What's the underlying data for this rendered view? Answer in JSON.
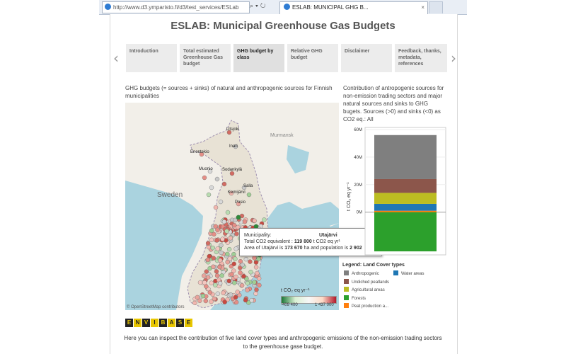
{
  "browser": {
    "url": "http://www.d3.ymparisto.fi/d3/test_services/ESLab",
    "tab_title": "ESLAB: MUNICIPAL GHG B...",
    "tab_close": "×"
  },
  "page": {
    "title": "ESLAB: Municipal Greenhouse Gas Budgets",
    "nav_tabs": [
      {
        "label": "Introduction"
      },
      {
        "label": "Total estimated Greenhouse Gas budget"
      },
      {
        "label": "GHG budget by class"
      },
      {
        "label": "Relative GHG budget"
      },
      {
        "label": "Disclaimer"
      },
      {
        "label": "Feedback, thanks, metadata, references"
      }
    ],
    "active_tab": "GHG budget by class",
    "prev_arrow": "‹",
    "next_arrow": "›",
    "footer": "Here you can inspect the contribution of five land cover types and anthropogenic emissions of the non-emission trading sectors to the greenhouse gase budget."
  },
  "map_panel": {
    "description": "GHG budgets (= sources + sinks) of natural and anthropogenic sources for Finnish municipalities",
    "labels": {
      "sweden": "Sweden",
      "murmansk": "Murmansk",
      "utsjoki": "Utsjoki",
      "inari": "Inari",
      "enontekio": "Enontekio",
      "muonio": "Muonio",
      "sodankyla": "Sodankylä",
      "salla": "Salla",
      "kemijarvi": "Kemijärvi",
      "posio": "Posio"
    },
    "attribution": "© OpenStreetMap contributors",
    "scale": {
      "unit": "t CO₂  eq yr⁻¹",
      "min": "-409 400",
      "max": "1 437 000"
    },
    "logo_letters": [
      "E",
      "N",
      "V",
      "I",
      "B",
      "A",
      "S",
      "E"
    ],
    "tooltip": {
      "municipality_label": "Municipality:",
      "municipality_value": "Utajärvi",
      "total_label": "Total CO2 equivalent :",
      "total_value": "119 800",
      "total_unit": "t CO2 eq yr¹",
      "area_prefix": "Area of Utajärvi is",
      "area_value": "173 670",
      "area_mid": "ha and population is",
      "population_value": "2 902"
    }
  },
  "chart_panel": {
    "description": "Contribution of antropogenic sources for non-emission trading sectors and major natural sources and sinks to GHG bugets. Sources (>0) and sinks (<0)  as CO2 eq.: All",
    "legend_title": "Legend: Land Cover types",
    "legend_items": [
      {
        "name": "Anthropogenic",
        "color": "#7f7f7f"
      },
      {
        "name": "Water areas",
        "color": "#1f77b4"
      },
      {
        "name": "Undiched peatlands",
        "color": "#8c564b"
      },
      {
        "name": "Agricultural areas",
        "color": "#bcbd22"
      },
      {
        "name": "Forests",
        "color": "#2ca02c"
      },
      {
        "name": "Peat production a...",
        "color": "#ff7f0e"
      }
    ]
  },
  "chart_data": {
    "type": "bar",
    "stacked": true,
    "categories": [
      "All"
    ],
    "ylabel": "t CO₂  eq yr⁻¹",
    "yticks": [
      "60M",
      "40M",
      "20M",
      "0M"
    ],
    "ylim": [
      -29,
      60
    ],
    "series": [
      {
        "name": "Forests",
        "values": [
          -28.5
        ],
        "color": "#2ca02c"
      },
      {
        "name": "Peat production a...",
        "values": [
          1
        ],
        "color": "#ff7f0e"
      },
      {
        "name": "Water areas",
        "values": [
          5
        ],
        "color": "#1f77b4"
      },
      {
        "name": "Agricultural areas",
        "values": [
          8
        ],
        "color": "#bcbd22"
      },
      {
        "name": "Undiched peatlands",
        "values": [
          10
        ],
        "color": "#8c564b"
      },
      {
        "name": "Anthropogenic",
        "values": [
          32
        ],
        "color": "#7f7f7f"
      }
    ]
  }
}
